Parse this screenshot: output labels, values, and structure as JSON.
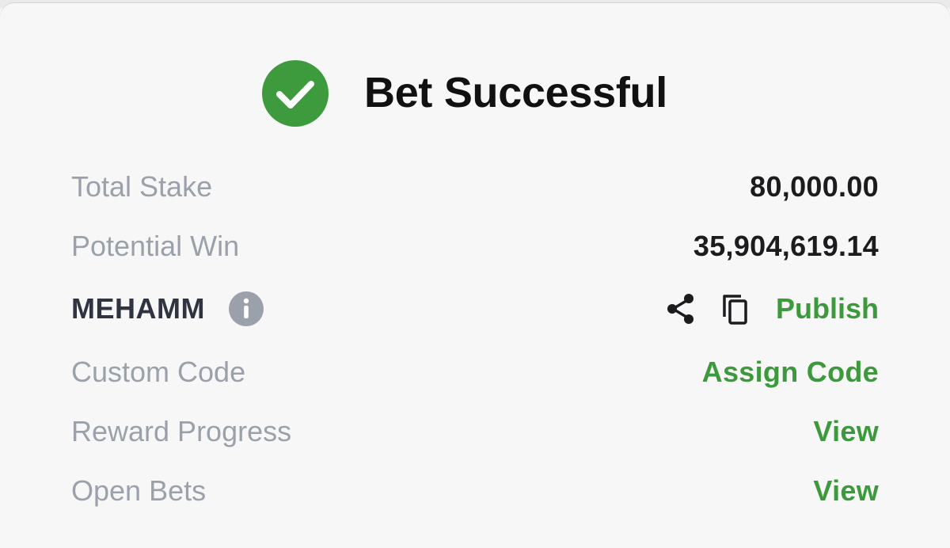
{
  "header": {
    "title": "Bet Successful"
  },
  "summary": {
    "total_stake_label": "Total Stake",
    "total_stake_value": "80,000.00",
    "potential_win_label": "Potential Win",
    "potential_win_value": "35,904,619.14",
    "booking_code": "MEHAMM",
    "publish_label": "Publish",
    "custom_code_label": "Custom Code",
    "assign_code_label": "Assign Code",
    "reward_progress_label": "Reward Progress",
    "reward_view_label": "View",
    "open_bets_label": "Open Bets",
    "open_bets_view_label": "View"
  },
  "icons": {
    "success": "check-circle-icon",
    "info": "info-icon",
    "share": "share-icon",
    "copy": "copy-icon"
  },
  "colors": {
    "accent_green": "#3c9a3c",
    "success_green": "#3d9a3d",
    "label_gray": "#9ba1ab",
    "value_dark": "#1c1c1e"
  }
}
